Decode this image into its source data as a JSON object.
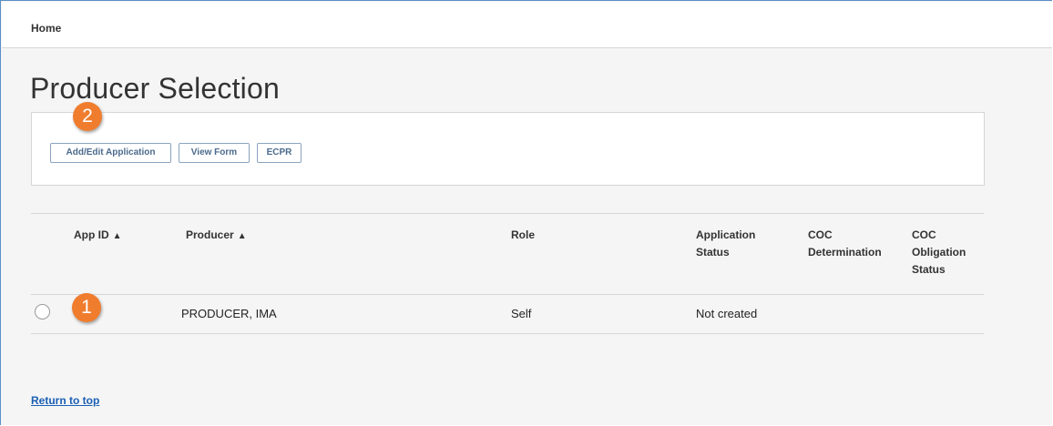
{
  "breadcrumb": "Home",
  "page_title": "Producer Selection",
  "toolbar": {
    "add_edit_label": "Add/Edit Application",
    "view_form_label": "View Form",
    "ecpr_label": "ECPR"
  },
  "table": {
    "headers": {
      "app_id": "App ID",
      "producer": "Producer",
      "role": "Role",
      "application_status": "Application Status",
      "coc_determination": "COC Determination",
      "coc_obligation_status": "COC Obligation Status"
    },
    "sort_icon": "chevron-up-icon",
    "rows": [
      {
        "app_id": "",
        "producer": "PRODUCER, IMA",
        "role": "Self",
        "application_status": "Not created",
        "coc_determination": "",
        "coc_obligation_status": ""
      }
    ]
  },
  "callouts": [
    "1",
    "2"
  ],
  "return_link": "Return to top",
  "colors": {
    "callout": "#f07d2e",
    "link": "#1a5fb4",
    "button_text": "#4b6a8c"
  }
}
